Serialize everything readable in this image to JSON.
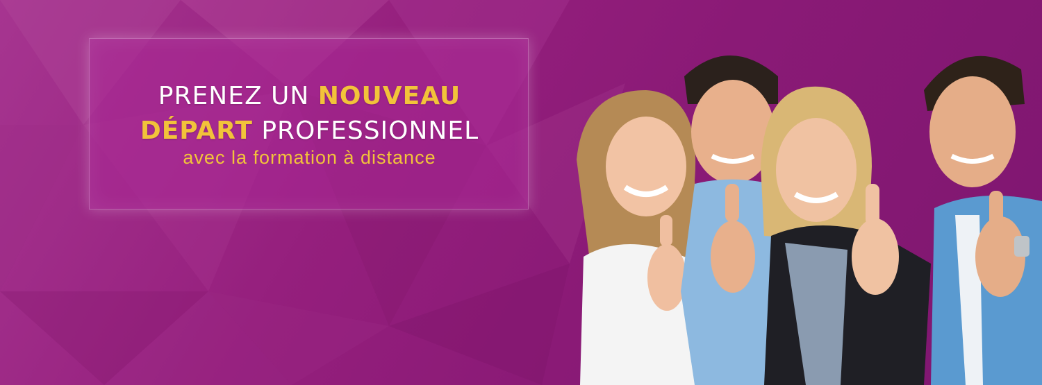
{
  "banner": {
    "headline": {
      "part1": "PRENEZ UN ",
      "highlight1": "NOUVEAU",
      "highlight2": "DÉPART",
      "part2": " PROFESSIONNEL"
    },
    "subline": "avec la formation à distance"
  },
  "colors": {
    "background": "#8e1a74",
    "highlight": "#f2c33a",
    "text": "#ffffff"
  }
}
